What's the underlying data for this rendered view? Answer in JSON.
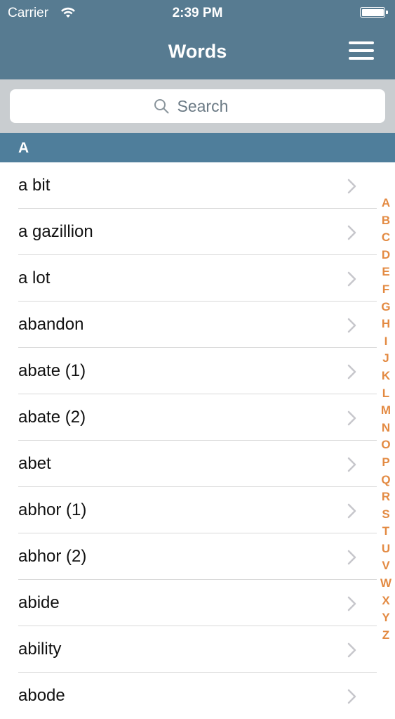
{
  "status_bar": {
    "carrier": "Carrier",
    "time": "2:39 PM"
  },
  "nav": {
    "title": "Words"
  },
  "search": {
    "placeholder": "Search"
  },
  "section": {
    "header": "A"
  },
  "words": [
    "a bit",
    "a gazillion",
    "a lot",
    "abandon",
    "abate (1)",
    "abate (2)",
    "abet",
    "abhor (1)",
    "abhor (2)",
    "abide",
    "ability",
    "abode"
  ],
  "index_letters": [
    "A",
    "B",
    "C",
    "D",
    "E",
    "F",
    "G",
    "H",
    "I",
    "J",
    "K",
    "L",
    "M",
    "N",
    "O",
    "P",
    "Q",
    "R",
    "S",
    "T",
    "U",
    "V",
    "W",
    "X",
    "Y",
    "Z"
  ],
  "colors": {
    "nav_bar": "#577b91",
    "section_header": "#4f7e9b",
    "index_accent": "#e38a42",
    "search_bar": "#c9cdd0"
  },
  "icons": {
    "menu": "hamburger-menu-icon",
    "search": "magnifier-icon",
    "chevron": "chevron-right-icon",
    "wifi": "wifi-icon",
    "battery": "battery-icon"
  }
}
